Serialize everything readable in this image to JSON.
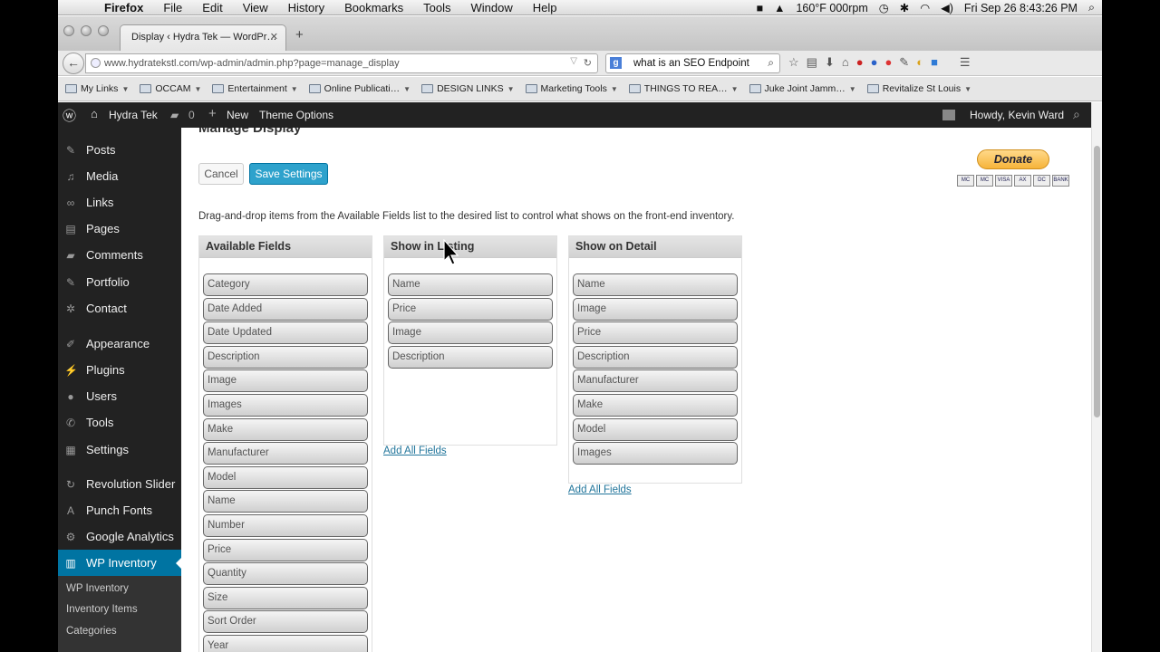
{
  "menubar": {
    "app": "Firefox",
    "items": [
      "File",
      "Edit",
      "View",
      "History",
      "Bookmarks",
      "Tools",
      "Window",
      "Help"
    ],
    "status_temp": "160°F 000rpm",
    "datetime": "Fri Sep 26  8:43:26 PM"
  },
  "tab": {
    "title": "Display ‹ Hydra Tek — WordPr…",
    "close": "✕"
  },
  "nav": {
    "url": "www.hydratekstl.com/wp-admin/admin.php?page=manage_display",
    "search": "what is an SEO Endpoint"
  },
  "bookmarks": [
    "My Links",
    "OCCAM",
    "Entertainment",
    "Online Publicati…",
    "DESIGN LINKS",
    "Marketing Tools",
    "THINGS TO REA…",
    "Juke Joint Jamm…",
    "Revitalize St Louis"
  ],
  "adminbar": {
    "site": "Hydra Tek",
    "comments": "0",
    "new": "New",
    "theme": "Theme Options",
    "howdy": "Howdy, Kevin Ward"
  },
  "sidebar": {
    "items": [
      "Posts",
      "Media",
      "Links",
      "Pages",
      "Comments",
      "Portfolio",
      "Contact",
      "Appearance",
      "Plugins",
      "Users",
      "Tools",
      "Settings",
      "Revolution Slider",
      "Punch Fonts",
      "Google Analytics",
      "WP Inventory"
    ],
    "sub": [
      "WP Inventory",
      "Inventory Items",
      "Categories"
    ]
  },
  "page": {
    "title": "Manage Display",
    "cancel": "Cancel",
    "save": "Save Settings",
    "donate": "Donate",
    "instructions": "Drag-and-drop items from the Available Fields list to the desired list to control what shows on the front-end inventory."
  },
  "columns": [
    {
      "title": "Available Fields",
      "fields": [
        "Category",
        "Date Added",
        "Date Updated",
        "Description",
        "Image",
        "Images",
        "Make",
        "Manufacturer",
        "Model",
        "Name",
        "Number",
        "Price",
        "Quantity",
        "Size",
        "Sort Order",
        "Year"
      ]
    },
    {
      "title": "Show in Listing",
      "fields": [
        "Name",
        "Price",
        "Image",
        "Description"
      ],
      "add_all": "Add All Fields"
    },
    {
      "title": "Show on Detail",
      "fields": [
        "Name",
        "Image",
        "Price",
        "Description",
        "Manufacturer",
        "Make",
        "Model",
        "Images"
      ],
      "add_all": "Add All Fields"
    }
  ],
  "colors": {
    "wp_dark": "#222222",
    "wp_active": "#0074a2",
    "save_btn": "#2ea2cc",
    "link": "#21759b"
  }
}
